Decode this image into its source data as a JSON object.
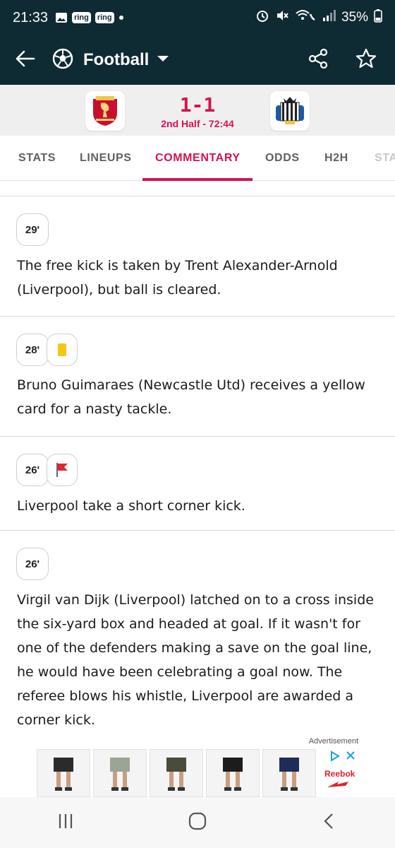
{
  "status_bar": {
    "time": "21:33",
    "badges": [
      "ring",
      "ring"
    ],
    "battery": "35%",
    "icons": [
      "gallery-icon",
      "alarm-icon",
      "mute-icon",
      "wifi-call-icon",
      "signal-icon"
    ]
  },
  "app_bar": {
    "title": "Football",
    "icons": [
      "back-arrow-icon",
      "football-icon",
      "dropdown-caret-icon",
      "share-icon",
      "star-icon"
    ]
  },
  "match": {
    "score": "1-1",
    "period": "2nd Half - 72:44",
    "home_logo": "liverpool-crest",
    "away_logo": "newcastle-crest",
    "accent_color": "#d6124f"
  },
  "tabs": [
    {
      "label": "STATS"
    },
    {
      "label": "LINEUPS"
    },
    {
      "label": "COMMENTARY"
    },
    {
      "label": "ODDS"
    },
    {
      "label": "H2H"
    },
    {
      "label": "STA"
    }
  ],
  "active_tab": "COMMENTARY",
  "commentary": [
    {
      "minute": "29'",
      "icon": "",
      "text": "The free kick is taken by Trent Alexander-Arnold (Liverpool), but ball is cleared."
    },
    {
      "minute": "28'",
      "icon": "yellow-card-icon",
      "text": "Bruno Guimaraes (Newcastle Utd) receives a yellow card for a nasty tackle."
    },
    {
      "minute": "26'",
      "icon": "corner-flag-icon",
      "text": "Liverpool take a short corner kick."
    },
    {
      "minute": "26'",
      "icon": "",
      "text": "Virgil van Dijk (Liverpool) latched on to a cross inside the six-yard box and headed at goal. If it wasn't for one of the defenders making a save on the goal line, he would have been celebrating a goal now. The referee blows his whistle, Liverpool are awarded a corner kick."
    }
  ],
  "ad": {
    "label": "Advertisement",
    "brand": "Reebok"
  }
}
